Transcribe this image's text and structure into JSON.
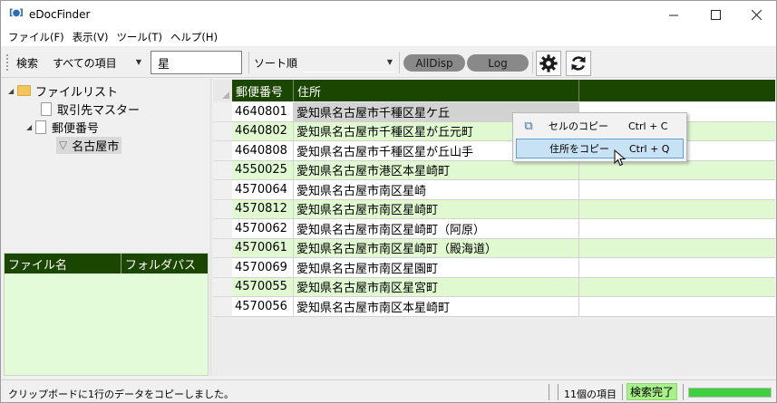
{
  "window": {
    "title": "eDocFinder",
    "minimize_icon": "minimize-icon",
    "maximize_icon": "maximize-icon",
    "close_icon": "close-icon"
  },
  "menu": {
    "items": [
      "ファイル(F)",
      "表示(V)",
      "ツール(T)",
      "ヘルプ(H)"
    ]
  },
  "toolbar": {
    "search_label": "検索",
    "scope_value": "すべての項目",
    "search_value": "星",
    "sort_label": "ソート順",
    "sort_value": "",
    "alldisp_label": "AllDisp",
    "log_label": "Log",
    "settings_icon": "gear-icon",
    "refresh_icon": "refresh-icon"
  },
  "tree": {
    "root": "ファイルリスト",
    "children": [
      "取引先マスター",
      "郵便番号"
    ],
    "filter": "名古屋市"
  },
  "file_list": {
    "columns": [
      "ファイル名",
      "フォルダパス"
    ]
  },
  "grid": {
    "columns": [
      "郵便番号",
      "住所"
    ],
    "rows": [
      [
        "4640801",
        "愛知県名古屋市千種区星ケ丘"
      ],
      [
        "4640802",
        "愛知県名古屋市千種区星が丘元町"
      ],
      [
        "4640808",
        "愛知県名古屋市千種区星が丘山手"
      ],
      [
        "4550025",
        "愛知県名古屋市港区本星崎町"
      ],
      [
        "4570064",
        "愛知県名古屋市南区星崎"
      ],
      [
        "4570812",
        "愛知県名古屋市南区星崎町"
      ],
      [
        "4570062",
        "愛知県名古屋市南区星崎町（阿原）"
      ],
      [
        "4570061",
        "愛知県名古屋市南区星崎町（殿海道）"
      ],
      [
        "4570069",
        "愛知県名古屋市南区星園町"
      ],
      [
        "4570055",
        "愛知県名古屋市南区星宮町"
      ],
      [
        "4570056",
        "愛知県名古屋市南区本星崎町"
      ]
    ]
  },
  "context_menu": {
    "items": [
      {
        "label": "セルのコピー",
        "shortcut": "Ctrl + C",
        "icon": "copy-icon"
      },
      {
        "label": "住所をコピー",
        "shortcut": "Ctrl + Q"
      }
    ]
  },
  "status": {
    "message": "クリップボードに1行のデータをコピーしました。",
    "count": "11個の項目",
    "state": "検索完了",
    "progress": 1.0,
    "progress_color": "#3fd03f"
  },
  "colors": {
    "header_green": "#1b4601",
    "alt_row": "#e0f9d0",
    "status_done": "#a8f08a"
  }
}
